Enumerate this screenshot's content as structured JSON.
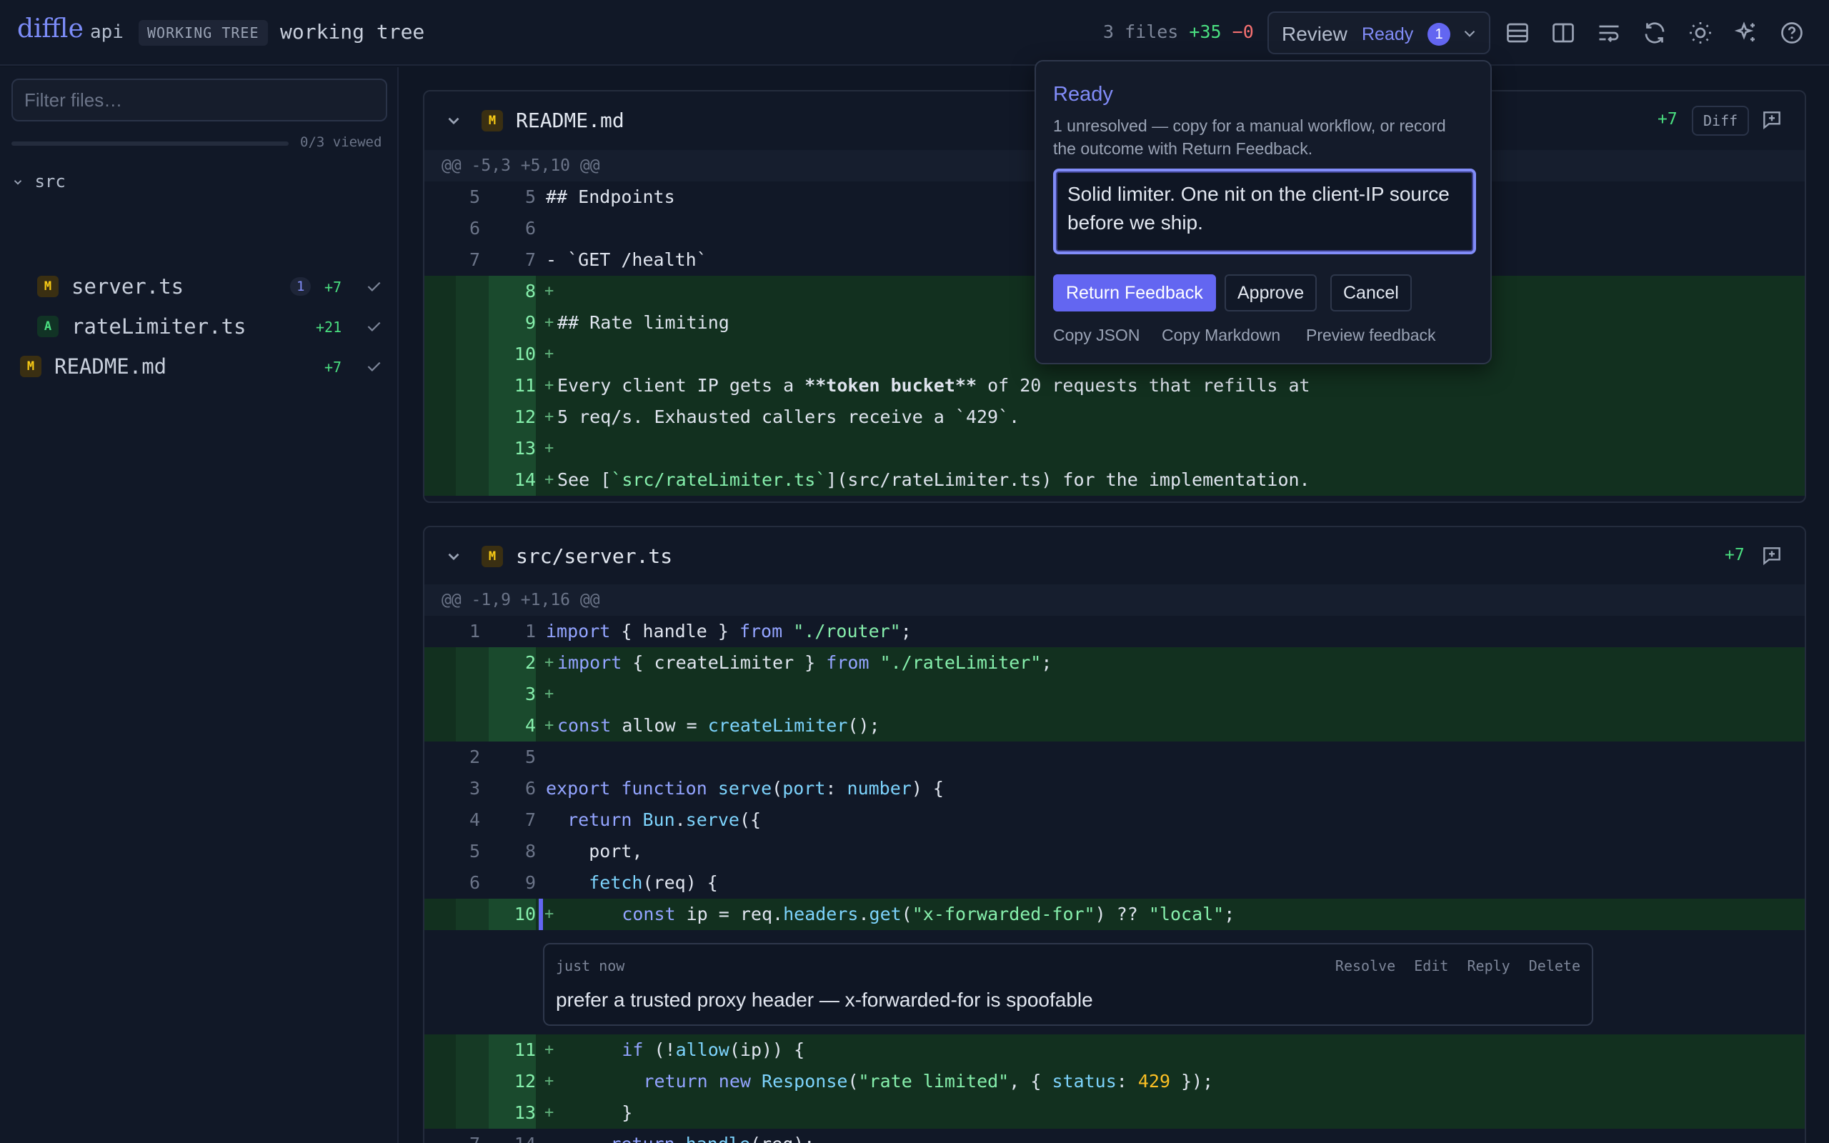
{
  "header": {
    "logo": "diffle",
    "repo": "api",
    "badge": "WORKING TREE",
    "subtitle": "working tree",
    "files": "3 files",
    "added": "+35",
    "removed": "−0",
    "review_label": "Review",
    "review_status": "Ready",
    "review_count": "1"
  },
  "sidebar": {
    "filter_placeholder": "Filter files…",
    "viewed": "0/3 viewed",
    "folder": "src",
    "files": [
      {
        "tag": "M",
        "name": "server.ts",
        "count": "1",
        "added": "+7"
      },
      {
        "tag": "A",
        "name": "rateLimiter.ts",
        "added": "+21"
      },
      {
        "tag": "M",
        "name": "README.md",
        "added": "+7"
      }
    ]
  },
  "readme": {
    "tag": "M",
    "name": "README.md",
    "added": "+7",
    "diff_label": "Diff",
    "hunk": "@@ -5,3 +5,10 @@",
    "lines": [
      {
        "old": "5",
        "new": "5",
        "text": "## Endpoints"
      },
      {
        "old": "6",
        "new": "6",
        "text": ""
      },
      {
        "old": "7",
        "new": "7",
        "text": "- `GET /health`"
      },
      {
        "new": "8",
        "text": ""
      },
      {
        "new": "9",
        "text": "## Rate limiting"
      },
      {
        "new": "10",
        "text": ""
      },
      {
        "new": "11",
        "text_a": "Every client IP gets a ",
        "text_b": "**token bucket**",
        "text_c": " of 20 requests that refills at"
      },
      {
        "new": "12",
        "text": "5 req/s. Exhausted callers receive a `429`."
      },
      {
        "new": "13",
        "text": ""
      },
      {
        "new": "14",
        "text_a": "See [",
        "text_b": "`src/rateLimiter.ts`",
        "text_c": "](src/rateLimiter.ts) for the implementation."
      }
    ]
  },
  "server": {
    "tag": "M",
    "name": "src/server.ts",
    "added": "+7",
    "hunk": "@@ -1,9 +1,16 @@",
    "lines": [
      {
        "old": "1",
        "new": "1"
      },
      {
        "new": "2"
      },
      {
        "new": "3"
      },
      {
        "new": "4"
      },
      {
        "old": "2",
        "new": "5"
      },
      {
        "old": "3",
        "new": "6"
      },
      {
        "old": "4",
        "new": "7"
      },
      {
        "old": "5",
        "new": "8"
      },
      {
        "old": "6",
        "new": "9"
      },
      {
        "new": "10"
      },
      {
        "new": "11"
      },
      {
        "new": "12"
      },
      {
        "new": "13"
      },
      {
        "old": "7",
        "new": "14"
      }
    ],
    "code": {
      "l1": [
        "import",
        " { handle } ",
        "from",
        " ",
        "\"./router\"",
        ";"
      ],
      "l2": [
        "import",
        " { createLimiter } ",
        "from",
        " ",
        "\"./rateLimiter\"",
        ";"
      ],
      "l4": [
        "const",
        " allow = ",
        "createLimiter",
        "();"
      ],
      "l6": [
        "export",
        " ",
        "function",
        " ",
        "serve",
        "(",
        "port",
        ": ",
        "number",
        ") {"
      ],
      "l7": [
        "  ",
        "return",
        " ",
        "Bun",
        ".",
        "serve",
        "({"
      ],
      "l8": "    port,",
      "l9": [
        "    ",
        "fetch",
        "(req) {"
      ],
      "l10": [
        "      ",
        "const",
        " ip = req.",
        "headers",
        ".",
        "get",
        "(",
        "\"x-forwarded-for\"",
        ") ?? ",
        "\"local\"",
        ";"
      ],
      "l11": [
        "      ",
        "if",
        " (!",
        "allow",
        "(ip)) {"
      ],
      "l12": [
        "        ",
        "return",
        " ",
        "new",
        " ",
        "Response",
        "(",
        "\"rate limited\"",
        ", { ",
        "status",
        ": ",
        "429",
        " });"
      ],
      "l13": "      }",
      "l14": [
        "      ",
        "return",
        " ",
        "handle",
        "(req);"
      ]
    }
  },
  "comment": {
    "time": "just now",
    "actions": [
      "Resolve",
      "Edit",
      "Reply",
      "Delete"
    ],
    "body": "prefer a trusted proxy header — x-forwarded-for is spoofable"
  },
  "popover": {
    "title": "Ready",
    "description": "1 unresolved — copy for a manual workflow, or record the outcome with Return Feedback.",
    "feedback": "Solid limiter. One nit on the client-IP source before we ship.",
    "return_feedback": "Return Feedback",
    "approve": "Approve",
    "cancel": "Cancel",
    "copy_json": "Copy JSON",
    "copy_markdown": "Copy Markdown",
    "preview": "Preview feedback"
  }
}
